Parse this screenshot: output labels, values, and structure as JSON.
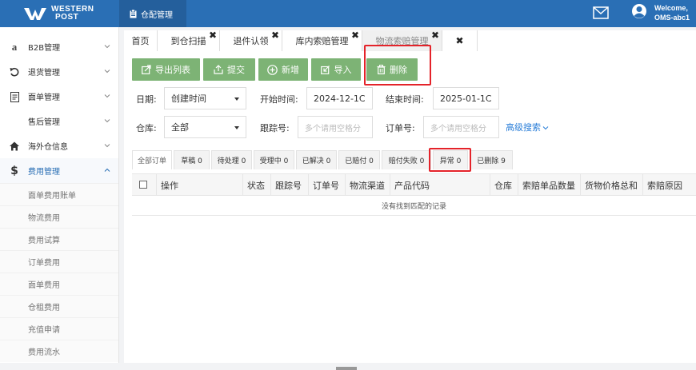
{
  "header": {
    "brand_line1": "WESTERN",
    "brand_line2": "POST",
    "module_label": "仓配管理",
    "welcome_line1": "Welcome,",
    "welcome_line2": "OMS-abc1",
    "accent_color": "#2a6fb5"
  },
  "sidebar": {
    "items": [
      {
        "label": "B2B管理",
        "icon": "amazon-a-icon"
      },
      {
        "label": "退货管理",
        "icon": "return-arrow-icon"
      },
      {
        "label": "面单管理",
        "icon": "document-icon"
      },
      {
        "label": "售后管理",
        "icon": "none"
      },
      {
        "label": "海外仓信息",
        "icon": "home-icon"
      },
      {
        "label": "费用管理",
        "icon": "dollar-icon"
      }
    ],
    "subitems": [
      "面单费用账单",
      "物流费用",
      "费用试算",
      "订单费用",
      "面单费用",
      "仓租费用",
      "充值申请",
      "费用流水"
    ]
  },
  "tabs": [
    {
      "label": "首页"
    },
    {
      "label": "到仓扫描"
    },
    {
      "label": "退件认领"
    },
    {
      "label": "库内索赔管理"
    },
    {
      "label": "物流索赔管理"
    },
    {
      "label": ""
    }
  ],
  "toolbar": {
    "export_label": "导出列表",
    "submit_label": "提交",
    "add_label": "新增",
    "import_label": "导入",
    "delete_label": "删除",
    "button_color": "#7db375",
    "highlight_color": "#e4232a"
  },
  "filters": {
    "date_label": "日期:",
    "date_type": "创建时间",
    "start_label": "开始时间:",
    "start_value": "2024-12-1C",
    "end_label": "结束时间:",
    "end_value": "2025-01-1C",
    "warehouse_label": "仓库:",
    "warehouse_value": "全部",
    "tracking_label": "跟踪号:",
    "tracking_placeholder": "多个请用空格分",
    "order_label": "订单号:",
    "order_placeholder": "多个请用空格分",
    "advanced_label": "高级搜索"
  },
  "status_tabs": [
    {
      "label": "全部订单"
    },
    {
      "label": "草稿 0"
    },
    {
      "label": "待处理 0"
    },
    {
      "label": "受理中 0"
    },
    {
      "label": "已解决 0"
    },
    {
      "label": "已赔付 0"
    },
    {
      "label": "赔付失败 0"
    },
    {
      "label": "异常 0"
    },
    {
      "label": "已删除 9"
    }
  ],
  "table": {
    "columns": [
      "操作",
      "状态",
      "跟踪号",
      "订单号",
      "物流渠道",
      "产品代码",
      "仓库",
      "索赔单品数量",
      "货物价格总和",
      "索赔原因"
    ],
    "empty_text": "没有找到匹配的记录"
  }
}
